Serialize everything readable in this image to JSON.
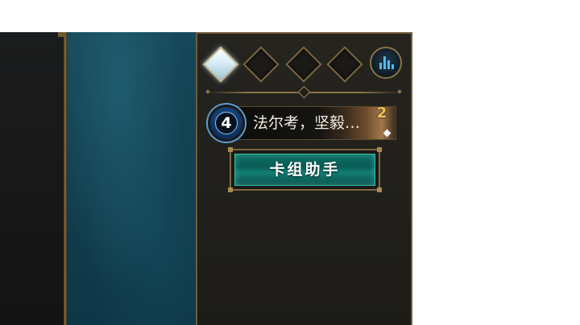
{
  "mana_gems": [
    {
      "state": "filled"
    },
    {
      "state": "empty"
    },
    {
      "state": "empty"
    },
    {
      "state": "empty"
    }
  ],
  "stats_button": {
    "icon": "bar-chart-icon",
    "color": "#52b9e8"
  },
  "deck_list": {
    "cards": [
      {
        "cost": "4",
        "name": "法尔考，坚毅…",
        "count": "2",
        "rarity": "diamond"
      }
    ]
  },
  "deck_assistant": {
    "label": "卡组助手"
  },
  "colors": {
    "gold_border": "#8a7447",
    "teal_panel": "#123f50",
    "button_teal": "#0d6d64",
    "cost_blue": "#1f5fa0",
    "count_gold": "#f2c25a"
  }
}
